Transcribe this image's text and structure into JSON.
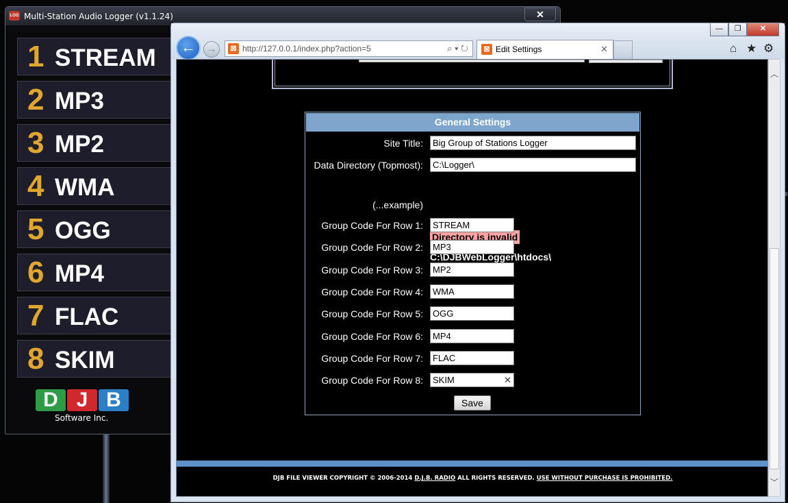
{
  "logger": {
    "title": "Multi-Station Audio Logger (v1.1.24)",
    "icon_text": "LOG",
    "close_label": "✕",
    "rows": [
      {
        "num": "1",
        "code": "STREAM"
      },
      {
        "num": "2",
        "code": "MP3"
      },
      {
        "num": "3",
        "code": "MP2"
      },
      {
        "num": "4",
        "code": "WMA"
      },
      {
        "num": "5",
        "code": "OGG"
      },
      {
        "num": "6",
        "code": "MP4"
      },
      {
        "num": "7",
        "code": "FLAC"
      },
      {
        "num": "8",
        "code": "SKIM"
      }
    ],
    "logo": {
      "letters": [
        "D",
        "J",
        "B"
      ],
      "text": "Software Inc."
    }
  },
  "browser": {
    "window_buttons": {
      "minimize": "—",
      "maximize": "❐",
      "close": "✕"
    },
    "back_label": "←",
    "forward_label": "→",
    "address": "http://127.0.0.1/index.php?action=5",
    "address_tools": "⌕ ▾ ↻",
    "favicon": "⊠",
    "tab_title": "Edit Settings",
    "tab_close": "✕",
    "toolbar_icons": {
      "home": "⌂",
      "favorites": "★",
      "tools": "⚙"
    },
    "scroll_up": "︿",
    "scroll_down": "﹀"
  },
  "settings": {
    "heading": "General Settings",
    "site_title_label": "Site Title:",
    "site_title_value": "Big Group of Stations Logger",
    "data_dir_label": "Data Directory (Topmost):",
    "data_dir_value": "C:\\Logger\\",
    "error": "Directory is invalid",
    "example_label": "(...example)",
    "example_value": "C:\\DJBWebLogger\\htdocs\\",
    "groups": [
      {
        "label": "Group Code For Row 1:",
        "value": "STREAM"
      },
      {
        "label": "Group Code For Row 2:",
        "value": "MP3"
      },
      {
        "label": "Group Code For Row 3:",
        "value": "MP2"
      },
      {
        "label": "Group Code For Row 4:",
        "value": "WMA"
      },
      {
        "label": "Group Code For Row 5:",
        "value": "OGG"
      },
      {
        "label": "Group Code For Row 6:",
        "value": "MP4"
      },
      {
        "label": "Group Code For Row 7:",
        "value": "FLAC"
      },
      {
        "label": "Group Code For Row 8:",
        "value": "SKIM"
      }
    ],
    "clear_icon": "✕",
    "save_label": "Save"
  },
  "footer": {
    "part1": "DJB FILE VIEWER COPYRIGHT © 2006-2014 ",
    "link": "D.J.B. RADIO",
    "part2": " ALL RIGHTS RESERVED. ",
    "notice": "USE WITHOUT PURCHASE IS PROHIBITED."
  },
  "colors": {
    "accent_number": "#e0a72e",
    "heading_bar": "#7ea6cc",
    "error_bg": "#ffa3a3",
    "logo_d": "#2e9b45",
    "logo_j": "#d0282c",
    "logo_b": "#2b7fc6"
  }
}
